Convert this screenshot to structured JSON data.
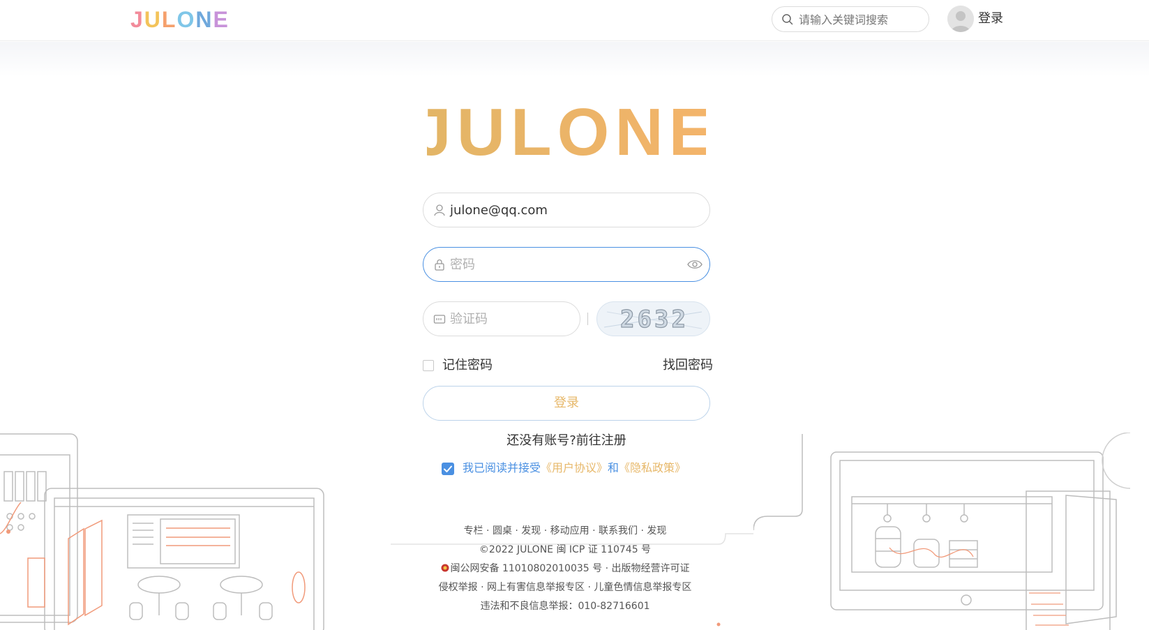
{
  "header": {
    "logo_text": "JULONE",
    "logo_letter_colors": [
      "#f28b9a",
      "#f3c35a",
      "#f5a06c",
      "#7fc6e8",
      "#6fa8dc",
      "#c792d9"
    ],
    "search_placeholder": "请输入关键词搜索",
    "login_label": "登录"
  },
  "brand": {
    "logo_text": "JULONE",
    "logo_gradient": [
      "#e2b566",
      "#f4b46a"
    ]
  },
  "form": {
    "username_value": "julone@qq.com",
    "password_placeholder": "密码",
    "captcha_placeholder": "验证码",
    "captcha_code": "2632",
    "remember_label": "记住密码",
    "remember_checked": false,
    "forgot_label": "找回密码",
    "login_button": "登录",
    "register_text": "还没有账号?前往注册",
    "agreement_checked": true,
    "agreement_prefix": "我已阅读并接受",
    "user_agreement": "《用户协议》",
    "agreement_and": "和",
    "privacy_policy": "《隐私政策》"
  },
  "footer": {
    "line1": "专栏 · 圆桌 · 发现 · 移动应用 · 联系我们 · 发现",
    "line2": "©2022 JULONE 闽 ICP 证 110745 号",
    "line3": "闽公网安备 11010802010035 号 · 出版物经营许可证",
    "line4": "侵权举报 · 网上有害信息举报专区 · 儿童色情信息举报专区",
    "line5": "违法和不良信息举报：010-82716601"
  },
  "colors": {
    "accent_blue": "#4a90e2",
    "accent_gold": "#e7b86a"
  }
}
